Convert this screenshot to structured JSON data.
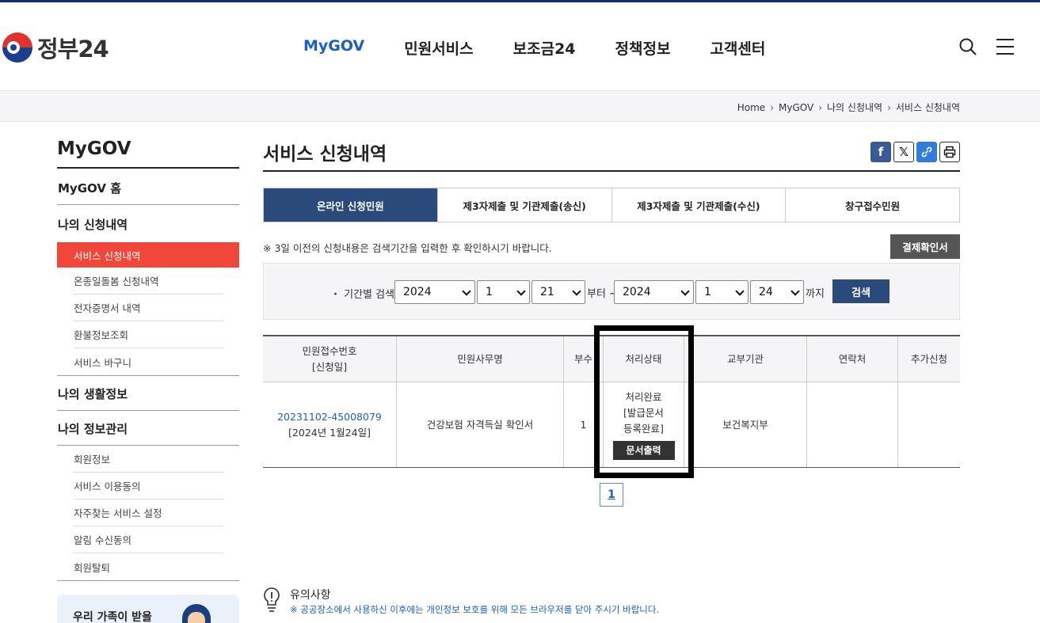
{
  "header": {
    "logo_text": "정부24",
    "nav": [
      "MyGOV",
      "민원서비스",
      "보조금24",
      "정책정보",
      "고객센터"
    ]
  },
  "breadcrumb": [
    "Home",
    "MyGOV",
    "나의 신청내역",
    "서비스 신청내역"
  ],
  "sidebar": {
    "title": "MyGOV",
    "home": "MyGOV 홈",
    "section_apply": "나의 신청내역",
    "apply_items": [
      "서비스 신청내역",
      "온종일돌봄 신청내역",
      "전자증명서 내역",
      "환불정보조회",
      "서비스 바구니"
    ],
    "section_life": "나의 생활정보",
    "section_info": "나의 정보관리",
    "info_items": [
      "회원정보",
      "서비스 이용동의",
      "자주찾는 서비스 설정",
      "알림 수신동의",
      "회원탈퇴"
    ],
    "banner_text": "우리 가족이 받을"
  },
  "main": {
    "title": "서비스 신청내역",
    "tabs": [
      "온라인 신청민원",
      "제3자제출 및 기관제출(송신)",
      "제3자제출 및 기관제출(수신)",
      "창구접수민원"
    ],
    "note": "※ 3일 이전의 신청내용은 검색기간을 입력한 후 확인하시기 바랍니다.",
    "payment_button": "결제확인서",
    "search": {
      "label": "・ 기간별 검색",
      "from_year": "2024",
      "from_month": "1",
      "from_day": "21",
      "from_word": "부터 ~",
      "to_year": "2024",
      "to_month": "1",
      "to_day": "24",
      "to_word": "까지",
      "button": "검색"
    },
    "table": {
      "headers": [
        "민원접수번호",
        "[신청일]",
        "민원사무명",
        "부수",
        "처리상태",
        "교부기관",
        "연락처",
        "추가신청"
      ],
      "row": {
        "receipt_no": "20231102-45008079",
        "date": "[2024년 1월24일]",
        "service": "건강보험 자격득실 확인서",
        "copies": "1",
        "status1": "처리완료",
        "status2": "[발급문서",
        "status3": "등록완료]",
        "print_button": "문서출력",
        "agency": "보건복지부",
        "contact": "",
        "extra": ""
      }
    },
    "page": "1",
    "notice_title": "유의사항",
    "notice_text": "※ 공공장소에서 사용하신 이후에는 개인정보 보호를 위해 모든 브라우저를 닫아 주시기 바랍니다."
  },
  "colors": {
    "accent": "#1b5ec8",
    "active_side": "#f0473a",
    "tab_active": "#2a4a7c"
  }
}
